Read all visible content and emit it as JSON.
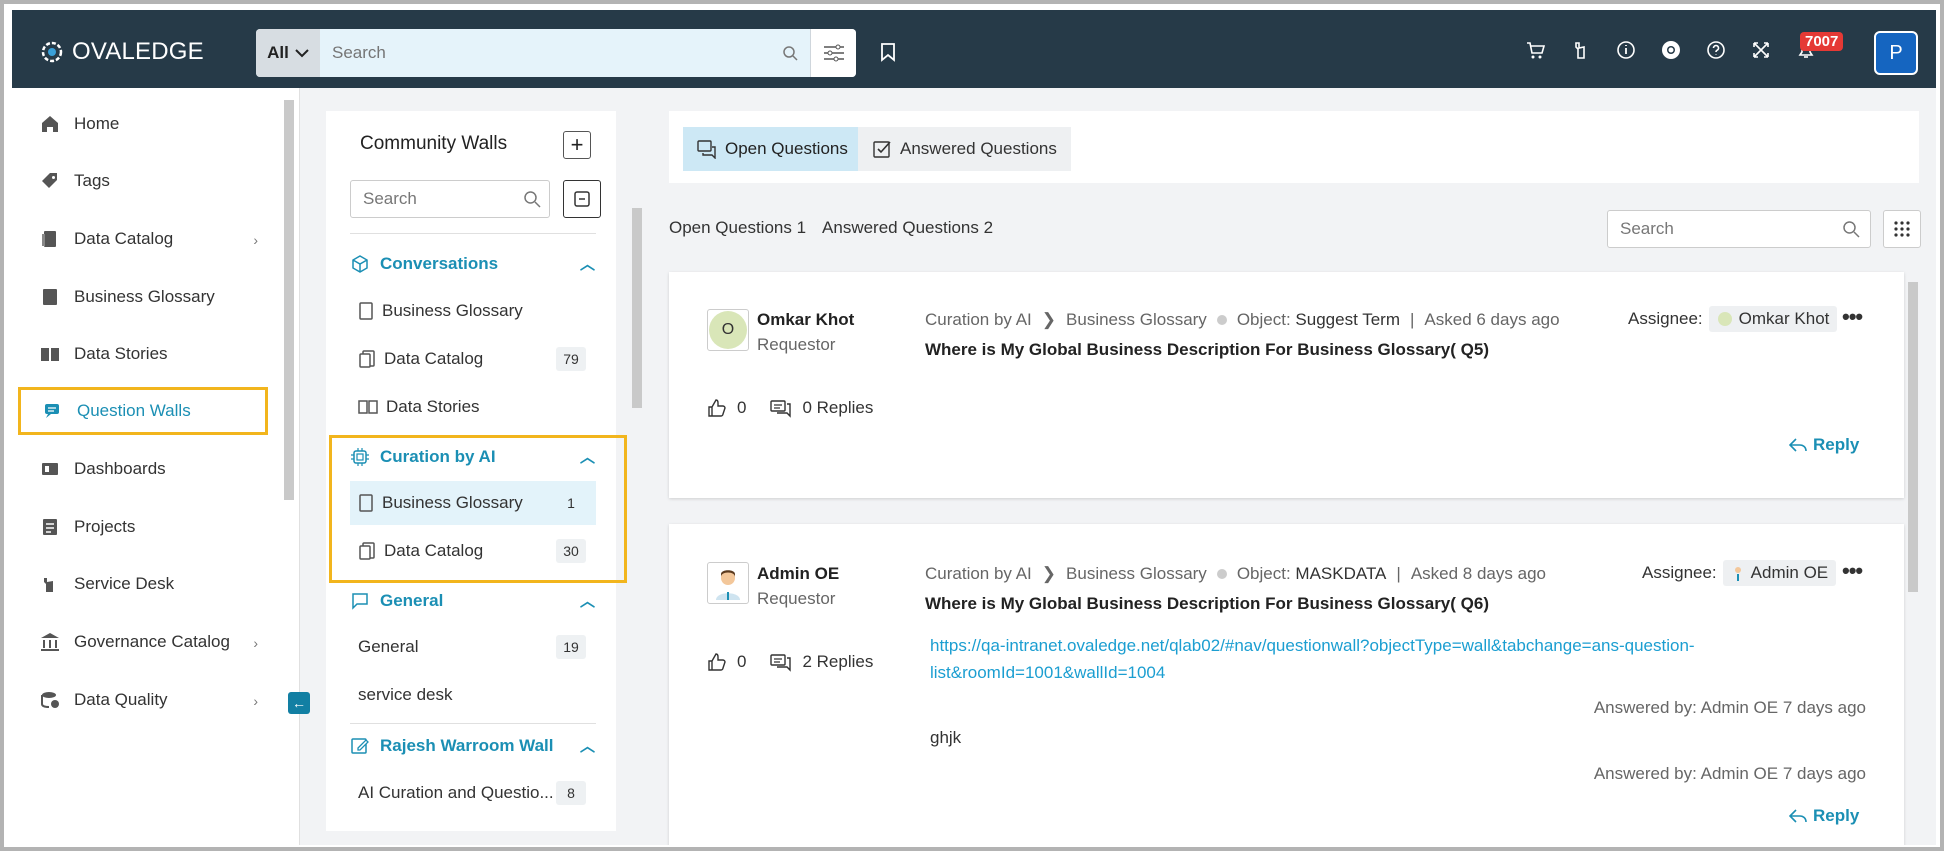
{
  "app": {
    "brand": "OVALEDGE",
    "notification_count": "7007",
    "user_initial": "P"
  },
  "search": {
    "scope": "All",
    "placeholder": "Search"
  },
  "topbar_icons": [
    "cart-icon",
    "hand-icon",
    "info-icon",
    "chrome-icon",
    "help-icon",
    "expand-icon",
    "bell-icon"
  ],
  "sidebar": {
    "items": [
      {
        "label": "Home",
        "icon": "home-icon",
        "chevron": false
      },
      {
        "label": "Tags",
        "icon": "tag-icon",
        "chevron": false
      },
      {
        "label": "Data Catalog",
        "icon": "catalog-icon",
        "chevron": true
      },
      {
        "label": "Business Glossary",
        "icon": "book-icon",
        "chevron": false
      },
      {
        "label": "Data Stories",
        "icon": "stories-icon",
        "chevron": false
      },
      {
        "label": "Question Walls",
        "icon": "chat-icon",
        "chevron": false,
        "active": true
      },
      {
        "label": "Dashboards",
        "icon": "dashboard-icon",
        "chevron": false
      },
      {
        "label": "Projects",
        "icon": "projects-icon",
        "chevron": false
      },
      {
        "label": "Service Desk",
        "icon": "service-icon",
        "chevron": false
      },
      {
        "label": "Governance Catalog",
        "icon": "bank-icon",
        "chevron": true
      },
      {
        "label": "Data Quality",
        "icon": "quality-icon",
        "chevron": true
      }
    ]
  },
  "walls": {
    "title": "Community Walls",
    "search_placeholder": "Search",
    "sections": [
      {
        "name": "Conversations",
        "items": [
          {
            "label": "Business Glossary",
            "count": ""
          },
          {
            "label": "Data Catalog",
            "count": "79"
          },
          {
            "label": "Data Stories",
            "count": ""
          }
        ]
      },
      {
        "name": "Curation by AI",
        "items": [
          {
            "label": "Business Glossary",
            "count": "1"
          },
          {
            "label": "Data Catalog",
            "count": "30"
          }
        ]
      },
      {
        "name": "General",
        "items": [
          {
            "label": "General",
            "count": "19"
          },
          {
            "label": "service desk",
            "count": ""
          }
        ]
      },
      {
        "name": "Rajesh Warroom Wall",
        "items": [
          {
            "label": "AI Curation and Questio...",
            "count": "8"
          }
        ]
      }
    ]
  },
  "main": {
    "tabs": [
      "Open Questions",
      "Answered Questions"
    ],
    "open_count_label": "Open Questions 1",
    "answered_count_label": "Answered Questions 2",
    "search_placeholder": "Search",
    "questions": [
      {
        "avatar": "O",
        "user": "Omkar Khot",
        "role": "Requestor",
        "wall": "Curation by AI",
        "sub_wall": "Business Glossary",
        "object_label": "Object:",
        "object": "Suggest Term",
        "asked": "Asked 6 days ago",
        "title": "Where is My Global Business Description For Business Glossary( Q5)",
        "assignee_label": "Assignee:",
        "assignee": "Omkar Khot",
        "likes": "0",
        "replies": "0 Replies",
        "reply_label": "Reply"
      },
      {
        "avatar": "",
        "user": "Admin OE",
        "role": "Requestor",
        "wall": "Curation by AI",
        "sub_wall": "Business Glossary",
        "object_label": "Object:",
        "object": "MASKDATA",
        "asked": "Asked 8 days ago",
        "title": "Where is My Global Business Description For Business Glossary( Q6)",
        "assignee_label": "Assignee:",
        "assignee": "Admin OE",
        "likes": "0",
        "replies": "2 Replies",
        "reply_label": "Reply",
        "answers": [
          {
            "text": "https://qa-intranet.ovaledge.net/qlab02/#nav/questionwall?objectType=wall&tabchange=ans-question-list&roomId=1001&wallId=1004",
            "by": "Answered by: Admin OE  7 days ago"
          },
          {
            "text": "ghjk",
            "by": "Answered by: Admin OE  7 days ago"
          }
        ]
      }
    ]
  },
  "colors": {
    "topbar": "#263a48",
    "accent": "#1b8fb4",
    "highlight": "#f2b51d",
    "badge": "#e53935"
  }
}
